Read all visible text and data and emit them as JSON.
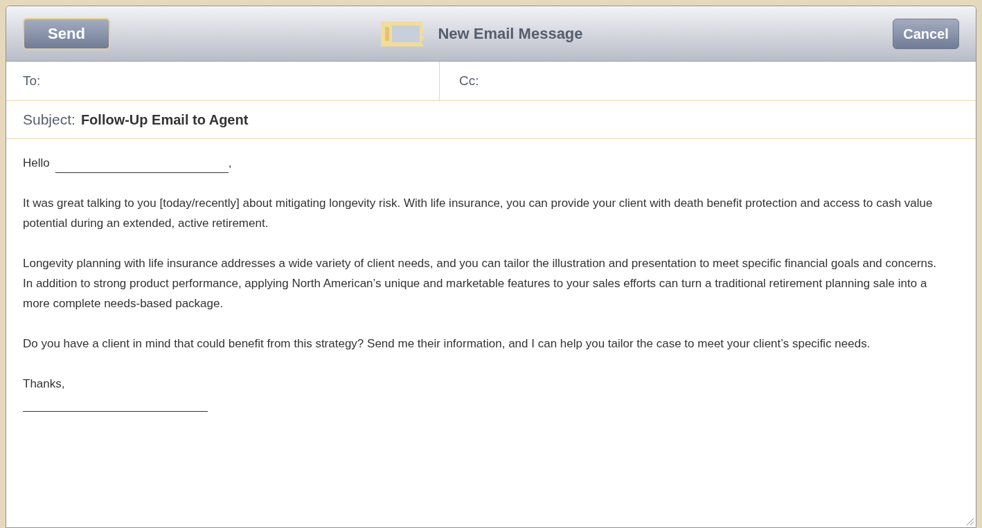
{
  "toolbar": {
    "send_button": "Send",
    "title": "New Email Message",
    "cancel_button": "Cancel"
  },
  "fields": {
    "to_label": "To:",
    "cc_label": "Cc:",
    "subject_label": "Subject:",
    "subject_value": "Follow-Up Email to Agent"
  },
  "body": {
    "greeting": "Hello",
    "greeting_end": ",",
    "paragraphs": [
      "It was great talking to you [today/recently] about mitigating longevity risk. With life insurance, you can provide your client with death benefit protection and access to cash value potential during an extended, active retirement.",
      "Longevity planning with life insurance addresses a wide variety of client needs, and you can tailor the illustration and presentation to meet specific financial goals and concerns. In addition to strong product performance, applying North American’s unique and marketable features to your sales efforts can turn a traditional retirement planning sale into a more complete needs-based package.",
      "Do you have a client in mind that could benefit from this strategy? Send me their information, and I can help you tailor the case to meet your client’s specific needs."
    ],
    "closing": "Thanks,"
  }
}
